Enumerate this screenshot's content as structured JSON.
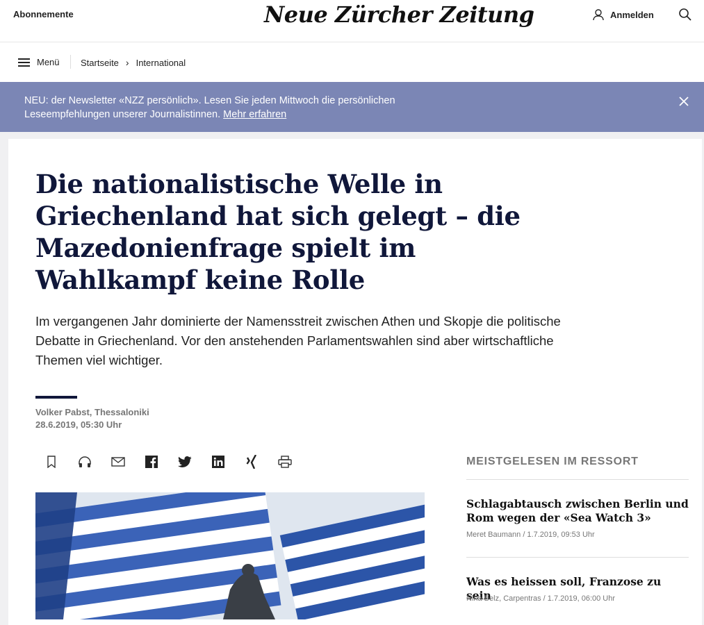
{
  "header": {
    "subscription_label": "Abonnemente",
    "logo_text": "Neue Zürcher Zeitung",
    "login_label": "Anmelden"
  },
  "nav": {
    "menu_label": "Menü",
    "breadcrumb": [
      "Startseite",
      "International"
    ]
  },
  "banner": {
    "text": "NEU: der Newsletter «NZZ persönlich». Lesen Sie jeden Mittwoch die persönlichen Leseempfehlungen unserer Journalistinnen.",
    "link_label": "Mehr erfahren"
  },
  "article": {
    "headline": "Die nationalistische Welle in Griechenland hat sich gelegt – die Mazedonienfrage spielt im Wahlkampf keine Rolle",
    "lead": "Im vergangenen Jahr dominierte der Namensstreit zwischen Athen und Skopje die politische Debatte in Griechenland. Vor den anstehenden Parlamentswahlen sind aber wirtschaftliche Themen viel wichtiger.",
    "author": "Volker Pabst, Thessaloniki",
    "date": "28.6.2019, 05:30 Uhr"
  },
  "share_icons": [
    "bookmark-icon",
    "headphones-icon",
    "mail-icon",
    "facebook-icon",
    "twitter-icon",
    "linkedin-icon",
    "xing-icon",
    "print-icon"
  ],
  "sidebar": {
    "title": "MEISTGELESEN IM RESSORT",
    "items": [
      {
        "headline": "Schlagabtausch zwischen Berlin und Rom wegen der «Sea Watch 3»",
        "meta": "Meret Baumann / 1.7.2019, 09:53 Uhr"
      },
      {
        "headline": "Was es heissen soll, Franzose zu sein",
        "meta": "Nina Belz, Carpentras / 1.7.2019, 06:00 Uhr"
      }
    ]
  },
  "colors": {
    "banner_bg": "#7b86b5",
    "headline": "#10173a",
    "meta_gray": "#767676"
  }
}
